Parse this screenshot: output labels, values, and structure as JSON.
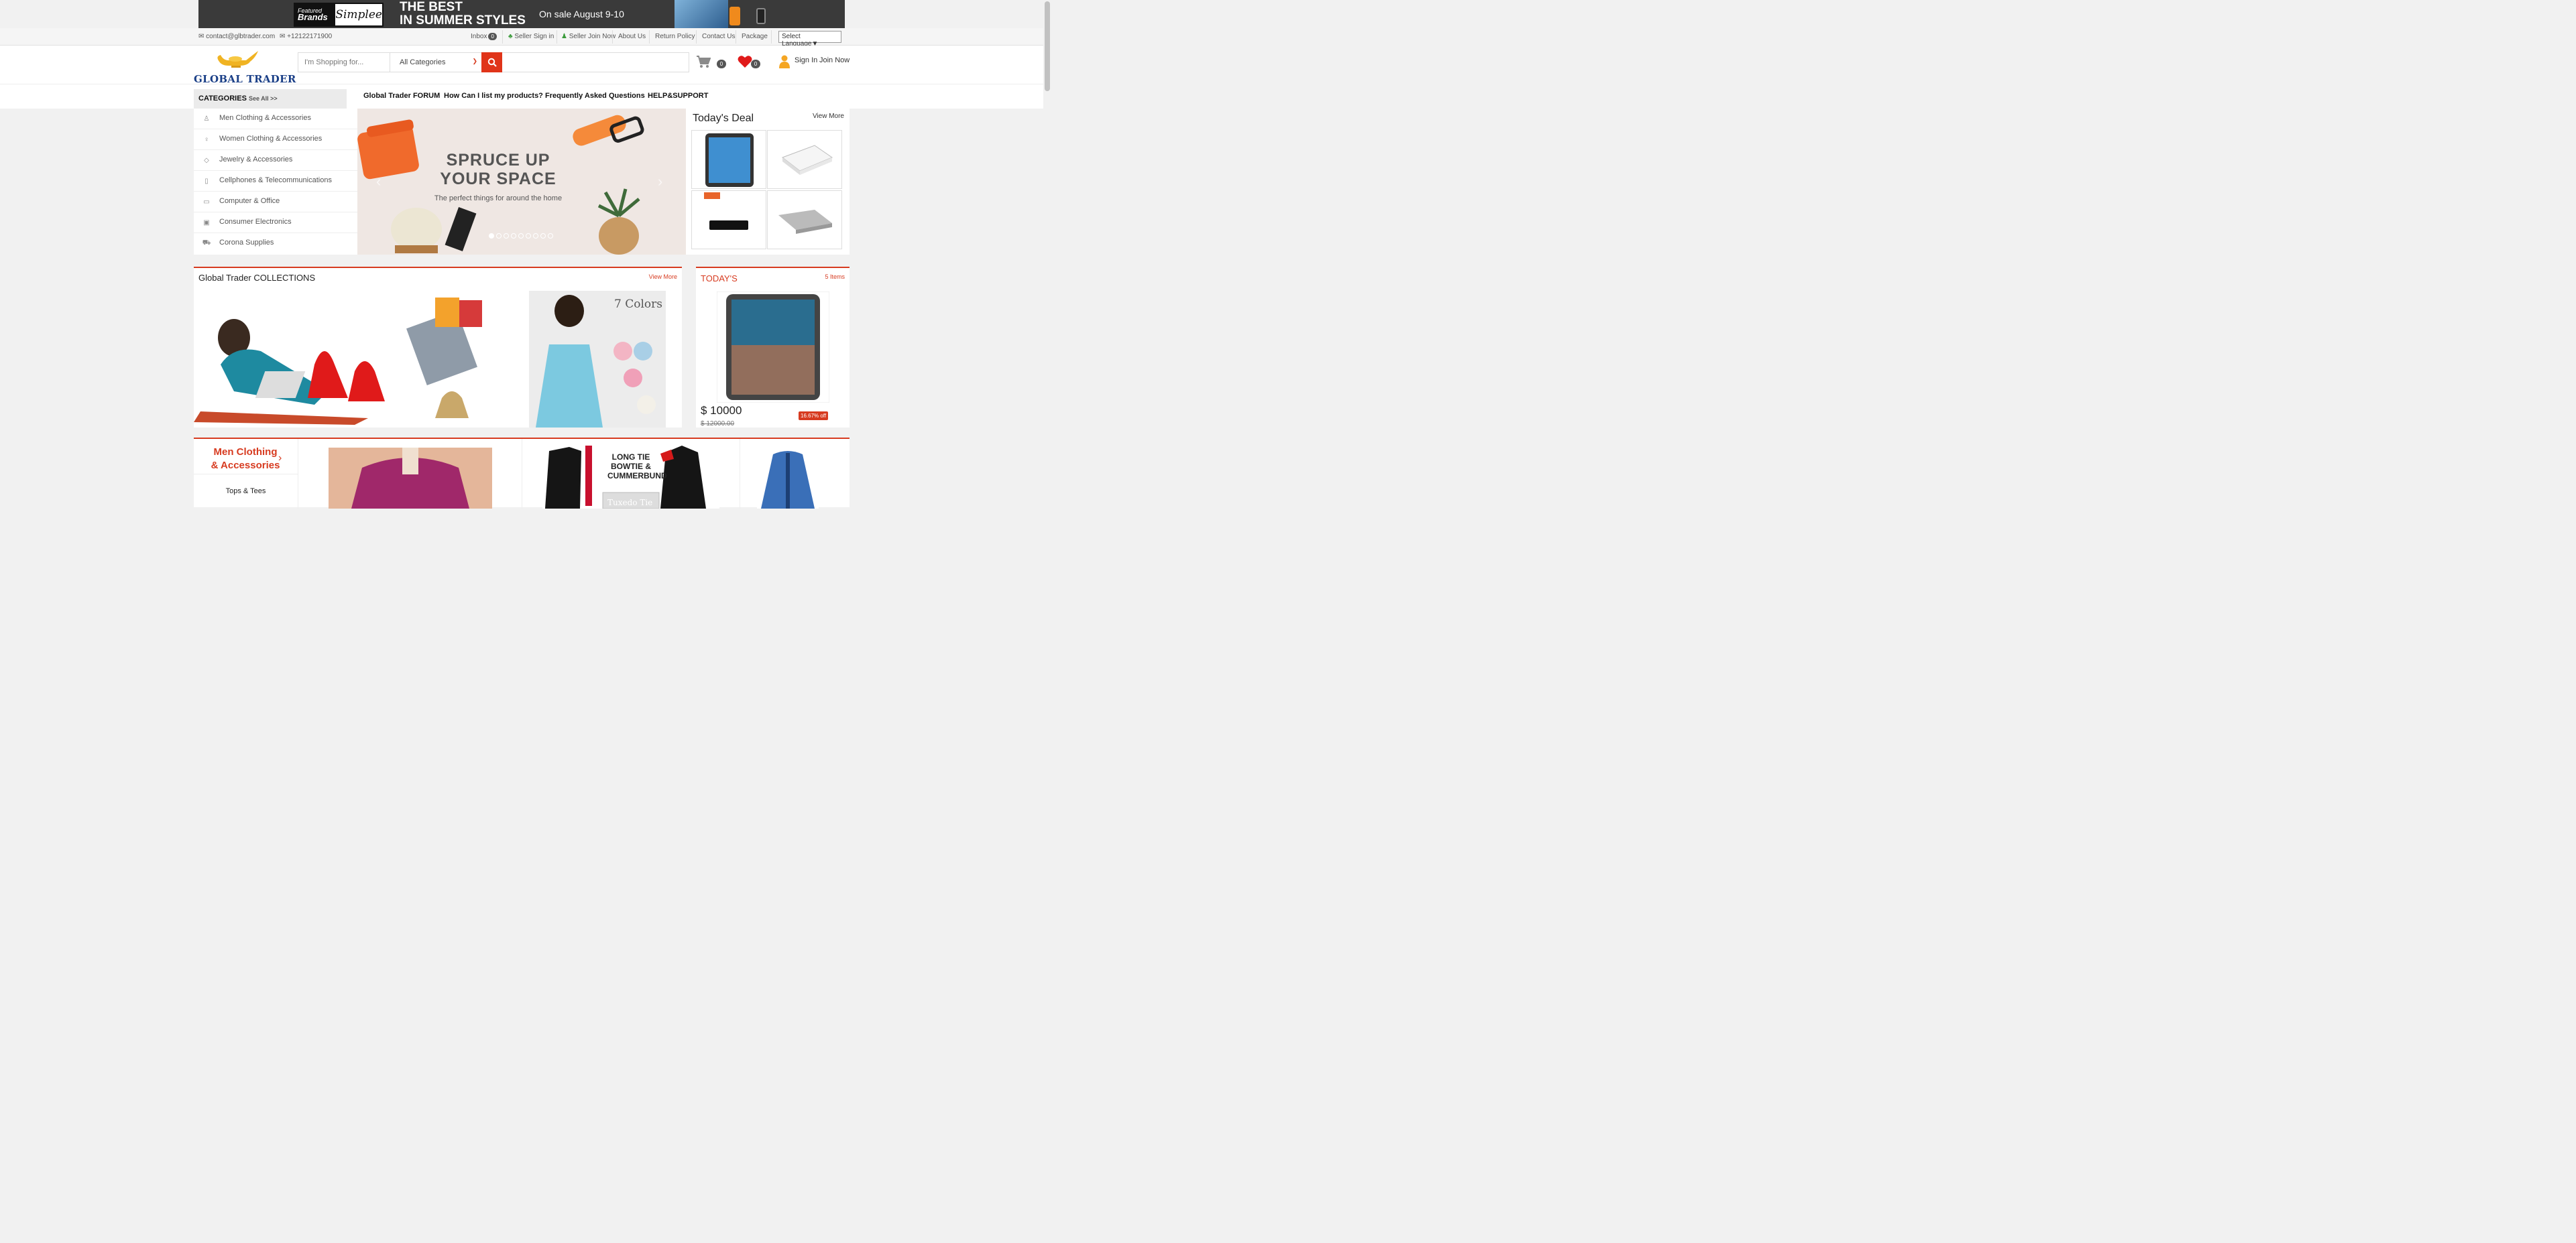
{
  "banner": {
    "featured": "Featured",
    "brands": "Brands",
    "simplee": "Simplee",
    "headline_1": "THE BEST",
    "headline_2": "IN SUMMER STYLES",
    "sale": "On sale August 9-10"
  },
  "infobar": {
    "email": "contact@glbtrader.com",
    "phone": "+12122171900",
    "inbox_label": "Inbox",
    "inbox_count": "0",
    "seller_signin": "Seller Sign in",
    "seller_join": "Seller Join Now",
    "about": "About Us",
    "return_policy": "Return Policy",
    "contact": "Contact Us",
    "package": "Package",
    "language": "Select Language▼"
  },
  "header": {
    "logo_text": "GLOBAL TRADER",
    "search_placeholder": "I'm Shopping for...",
    "category_selected": "All Categories",
    "cart_count": "0",
    "wishlist_count": "0",
    "sign_in": "Sign In",
    "join_now": "Join Now"
  },
  "nav": {
    "categories_label": "CATEGORIES",
    "see_all": "See All >>",
    "links": [
      "Global Trader FORUM",
      "How Can I list my products?",
      "Frequently Asked Questions",
      "HELP&SUPPORT"
    ]
  },
  "categories": [
    {
      "label": "Men Clothing & Accessories",
      "icon": "person-icon"
    },
    {
      "label": "Women Clothing & Accessories",
      "icon": "woman-icon"
    },
    {
      "label": "Jewelry & Accessories",
      "icon": "diamond-icon"
    },
    {
      "label": "Cellphones & Telecommunications",
      "icon": "phone-icon"
    },
    {
      "label": "Computer & Office",
      "icon": "monitor-icon"
    },
    {
      "label": "Consumer Electronics",
      "icon": "camera-icon"
    },
    {
      "label": "Corona Supplies",
      "icon": "truck-icon"
    }
  ],
  "slider": {
    "title_1": "SPRUCE UP",
    "title_2": "YOUR SPACE",
    "subtitle": "The perfect things for around the home",
    "slide_count": 9,
    "active_slide": 1
  },
  "deal": {
    "title": "Today's Deal",
    "view_more": "View More"
  },
  "collections": {
    "title": "Global Trader COLLECTIONS",
    "view_more": "View More",
    "colors_text": "7 Colors"
  },
  "todays": {
    "title": "TODAY'S",
    "items": "5 Items",
    "price": "$ 10000",
    "old_price": "$ 12000.00",
    "discount": "16.67% off"
  },
  "men_section": {
    "title_1": "Men Clothing",
    "title_2": "& Accessories",
    "sub_item": "Tops & Tees",
    "tie_text_1": "LONG TIE",
    "tie_text_2": "BOWTIE &",
    "tie_text_3": "CUMMERBUND",
    "tie_text_4": "Tuxedo Tie"
  },
  "colors": {
    "accent": "#e03419",
    "logo_blue": "#1a3f87"
  }
}
